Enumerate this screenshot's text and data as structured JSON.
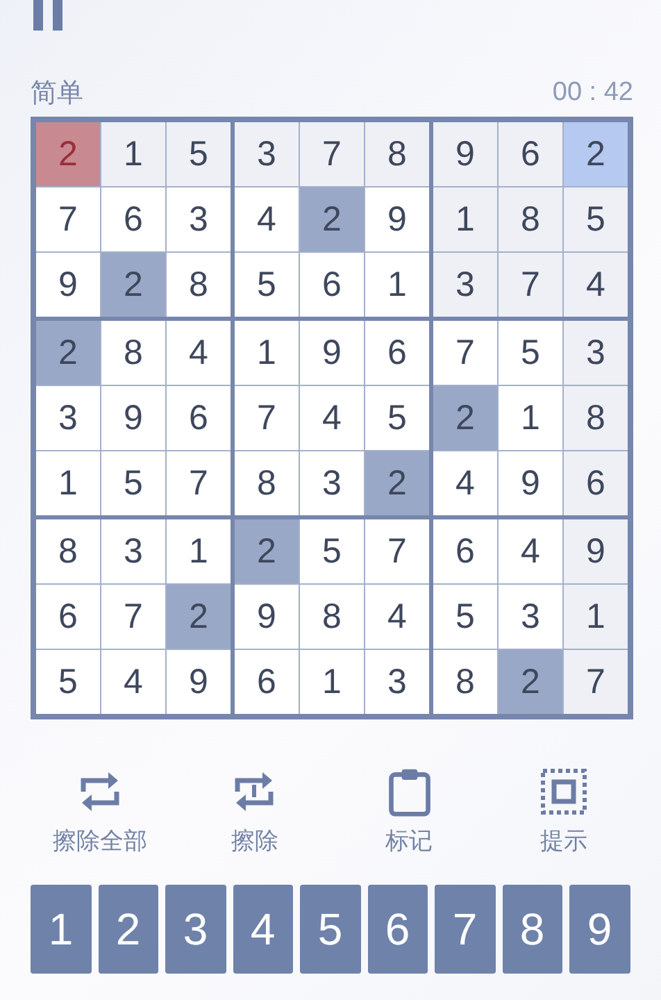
{
  "header": {
    "difficulty": "简单",
    "timer": "00 : 42"
  },
  "grid": [
    [
      {
        "v": "2",
        "selected": false,
        "error": true,
        "same": false,
        "related": false
      },
      {
        "v": "1",
        "selected": false,
        "error": false,
        "same": false,
        "related": true
      },
      {
        "v": "5",
        "selected": false,
        "error": false,
        "same": false,
        "related": true
      },
      {
        "v": "3",
        "selected": false,
        "error": false,
        "same": false,
        "related": true
      },
      {
        "v": "7",
        "selected": false,
        "error": false,
        "same": false,
        "related": true
      },
      {
        "v": "8",
        "selected": false,
        "error": false,
        "same": false,
        "related": true
      },
      {
        "v": "9",
        "selected": false,
        "error": false,
        "same": false,
        "related": true
      },
      {
        "v": "6",
        "selected": false,
        "error": false,
        "same": false,
        "related": true
      },
      {
        "v": "2",
        "selected": true,
        "error": false,
        "same": false,
        "related": false
      }
    ],
    [
      {
        "v": "7",
        "selected": false,
        "error": false,
        "same": false,
        "related": false
      },
      {
        "v": "6",
        "selected": false,
        "error": false,
        "same": false,
        "related": false
      },
      {
        "v": "3",
        "selected": false,
        "error": false,
        "same": false,
        "related": false
      },
      {
        "v": "4",
        "selected": false,
        "error": false,
        "same": false,
        "related": false
      },
      {
        "v": "2",
        "selected": false,
        "error": false,
        "same": true,
        "related": false
      },
      {
        "v": "9",
        "selected": false,
        "error": false,
        "same": false,
        "related": false
      },
      {
        "v": "1",
        "selected": false,
        "error": false,
        "same": false,
        "related": true
      },
      {
        "v": "8",
        "selected": false,
        "error": false,
        "same": false,
        "related": true
      },
      {
        "v": "5",
        "selected": false,
        "error": false,
        "same": false,
        "related": true
      }
    ],
    [
      {
        "v": "9",
        "selected": false,
        "error": false,
        "same": false,
        "related": false
      },
      {
        "v": "2",
        "selected": false,
        "error": false,
        "same": true,
        "related": false
      },
      {
        "v": "8",
        "selected": false,
        "error": false,
        "same": false,
        "related": false
      },
      {
        "v": "5",
        "selected": false,
        "error": false,
        "same": false,
        "related": false
      },
      {
        "v": "6",
        "selected": false,
        "error": false,
        "same": false,
        "related": false
      },
      {
        "v": "1",
        "selected": false,
        "error": false,
        "same": false,
        "related": false
      },
      {
        "v": "3",
        "selected": false,
        "error": false,
        "same": false,
        "related": true
      },
      {
        "v": "7",
        "selected": false,
        "error": false,
        "same": false,
        "related": true
      },
      {
        "v": "4",
        "selected": false,
        "error": false,
        "same": false,
        "related": true
      }
    ],
    [
      {
        "v": "2",
        "selected": false,
        "error": false,
        "same": true,
        "related": false
      },
      {
        "v": "8",
        "selected": false,
        "error": false,
        "same": false,
        "related": false
      },
      {
        "v": "4",
        "selected": false,
        "error": false,
        "same": false,
        "related": false
      },
      {
        "v": "1",
        "selected": false,
        "error": false,
        "same": false,
        "related": false
      },
      {
        "v": "9",
        "selected": false,
        "error": false,
        "same": false,
        "related": false
      },
      {
        "v": "6",
        "selected": false,
        "error": false,
        "same": false,
        "related": false
      },
      {
        "v": "7",
        "selected": false,
        "error": false,
        "same": false,
        "related": false
      },
      {
        "v": "5",
        "selected": false,
        "error": false,
        "same": false,
        "related": false
      },
      {
        "v": "3",
        "selected": false,
        "error": false,
        "same": false,
        "related": true
      }
    ],
    [
      {
        "v": "3",
        "selected": false,
        "error": false,
        "same": false,
        "related": false
      },
      {
        "v": "9",
        "selected": false,
        "error": false,
        "same": false,
        "related": false
      },
      {
        "v": "6",
        "selected": false,
        "error": false,
        "same": false,
        "related": false
      },
      {
        "v": "7",
        "selected": false,
        "error": false,
        "same": false,
        "related": false
      },
      {
        "v": "4",
        "selected": false,
        "error": false,
        "same": false,
        "related": false
      },
      {
        "v": "5",
        "selected": false,
        "error": false,
        "same": false,
        "related": false
      },
      {
        "v": "2",
        "selected": false,
        "error": false,
        "same": true,
        "related": false
      },
      {
        "v": "1",
        "selected": false,
        "error": false,
        "same": false,
        "related": false
      },
      {
        "v": "8",
        "selected": false,
        "error": false,
        "same": false,
        "related": true
      }
    ],
    [
      {
        "v": "1",
        "selected": false,
        "error": false,
        "same": false,
        "related": false
      },
      {
        "v": "5",
        "selected": false,
        "error": false,
        "same": false,
        "related": false
      },
      {
        "v": "7",
        "selected": false,
        "error": false,
        "same": false,
        "related": false
      },
      {
        "v": "8",
        "selected": false,
        "error": false,
        "same": false,
        "related": false
      },
      {
        "v": "3",
        "selected": false,
        "error": false,
        "same": false,
        "related": false
      },
      {
        "v": "2",
        "selected": false,
        "error": false,
        "same": true,
        "related": false
      },
      {
        "v": "4",
        "selected": false,
        "error": false,
        "same": false,
        "related": false
      },
      {
        "v": "9",
        "selected": false,
        "error": false,
        "same": false,
        "related": false
      },
      {
        "v": "6",
        "selected": false,
        "error": false,
        "same": false,
        "related": true
      }
    ],
    [
      {
        "v": "8",
        "selected": false,
        "error": false,
        "same": false,
        "related": false
      },
      {
        "v": "3",
        "selected": false,
        "error": false,
        "same": false,
        "related": false
      },
      {
        "v": "1",
        "selected": false,
        "error": false,
        "same": false,
        "related": false
      },
      {
        "v": "2",
        "selected": false,
        "error": false,
        "same": true,
        "related": false
      },
      {
        "v": "5",
        "selected": false,
        "error": false,
        "same": false,
        "related": false
      },
      {
        "v": "7",
        "selected": false,
        "error": false,
        "same": false,
        "related": false
      },
      {
        "v": "6",
        "selected": false,
        "error": false,
        "same": false,
        "related": false
      },
      {
        "v": "4",
        "selected": false,
        "error": false,
        "same": false,
        "related": false
      },
      {
        "v": "9",
        "selected": false,
        "error": false,
        "same": false,
        "related": true
      }
    ],
    [
      {
        "v": "6",
        "selected": false,
        "error": false,
        "same": false,
        "related": false
      },
      {
        "v": "7",
        "selected": false,
        "error": false,
        "same": false,
        "related": false
      },
      {
        "v": "2",
        "selected": false,
        "error": false,
        "same": true,
        "related": false
      },
      {
        "v": "9",
        "selected": false,
        "error": false,
        "same": false,
        "related": false
      },
      {
        "v": "8",
        "selected": false,
        "error": false,
        "same": false,
        "related": false
      },
      {
        "v": "4",
        "selected": false,
        "error": false,
        "same": false,
        "related": false
      },
      {
        "v": "5",
        "selected": false,
        "error": false,
        "same": false,
        "related": false
      },
      {
        "v": "3",
        "selected": false,
        "error": false,
        "same": false,
        "related": false
      },
      {
        "v": "1",
        "selected": false,
        "error": false,
        "same": false,
        "related": true
      }
    ],
    [
      {
        "v": "5",
        "selected": false,
        "error": false,
        "same": false,
        "related": false
      },
      {
        "v": "4",
        "selected": false,
        "error": false,
        "same": false,
        "related": false
      },
      {
        "v": "9",
        "selected": false,
        "error": false,
        "same": false,
        "related": false
      },
      {
        "v": "6",
        "selected": false,
        "error": false,
        "same": false,
        "related": false
      },
      {
        "v": "1",
        "selected": false,
        "error": false,
        "same": false,
        "related": false
      },
      {
        "v": "3",
        "selected": false,
        "error": false,
        "same": false,
        "related": false
      },
      {
        "v": "8",
        "selected": false,
        "error": false,
        "same": false,
        "related": false
      },
      {
        "v": "2",
        "selected": false,
        "error": false,
        "same": true,
        "related": false
      },
      {
        "v": "7",
        "selected": false,
        "error": false,
        "same": false,
        "related": true
      }
    ]
  ],
  "tools": [
    {
      "kind": "erase_all",
      "label": "擦除全部"
    },
    {
      "kind": "erase",
      "label": "擦除"
    },
    {
      "kind": "notes",
      "label": "标记"
    },
    {
      "kind": "hint",
      "label": "提示"
    }
  ],
  "keypad": [
    "1",
    "2",
    "3",
    "4",
    "5",
    "6",
    "7",
    "8",
    "9"
  ]
}
